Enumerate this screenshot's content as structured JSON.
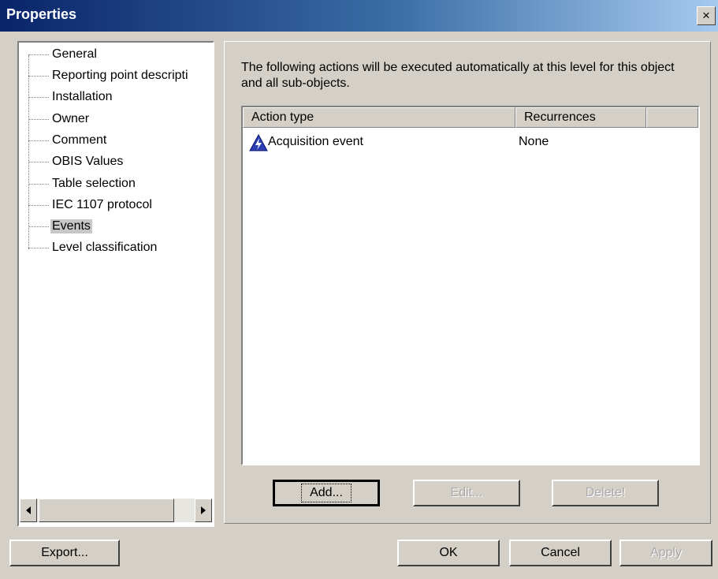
{
  "window": {
    "title": "Properties",
    "close_glyph": "×"
  },
  "tree": {
    "items": [
      {
        "label": "General",
        "selected": false
      },
      {
        "label": "Reporting point descripti",
        "selected": false
      },
      {
        "label": "Installation",
        "selected": false
      },
      {
        "label": "Owner",
        "selected": false
      },
      {
        "label": "Comment",
        "selected": false
      },
      {
        "label": "OBIS Values",
        "selected": false
      },
      {
        "label": "Table selection",
        "selected": false
      },
      {
        "label": "IEC 1107 protocol",
        "selected": false
      },
      {
        "label": "Events",
        "selected": true
      },
      {
        "label": "Level classification",
        "selected": false
      }
    ]
  },
  "events_page": {
    "description": "The following actions will be executed automatically at this level for this object and all sub-objects.",
    "list": {
      "columns": [
        "Action type",
        "Recurrences"
      ],
      "rows": [
        {
          "icon": "acquisition-event-icon",
          "action_type": "Acquisition event",
          "recurrences": "None"
        }
      ]
    },
    "buttons": {
      "add": "Add...",
      "edit": "Edit...",
      "delete": "Delete!"
    }
  },
  "footer": {
    "export": "Export...",
    "ok": "OK",
    "cancel": "Cancel",
    "apply": "Apply"
  }
}
